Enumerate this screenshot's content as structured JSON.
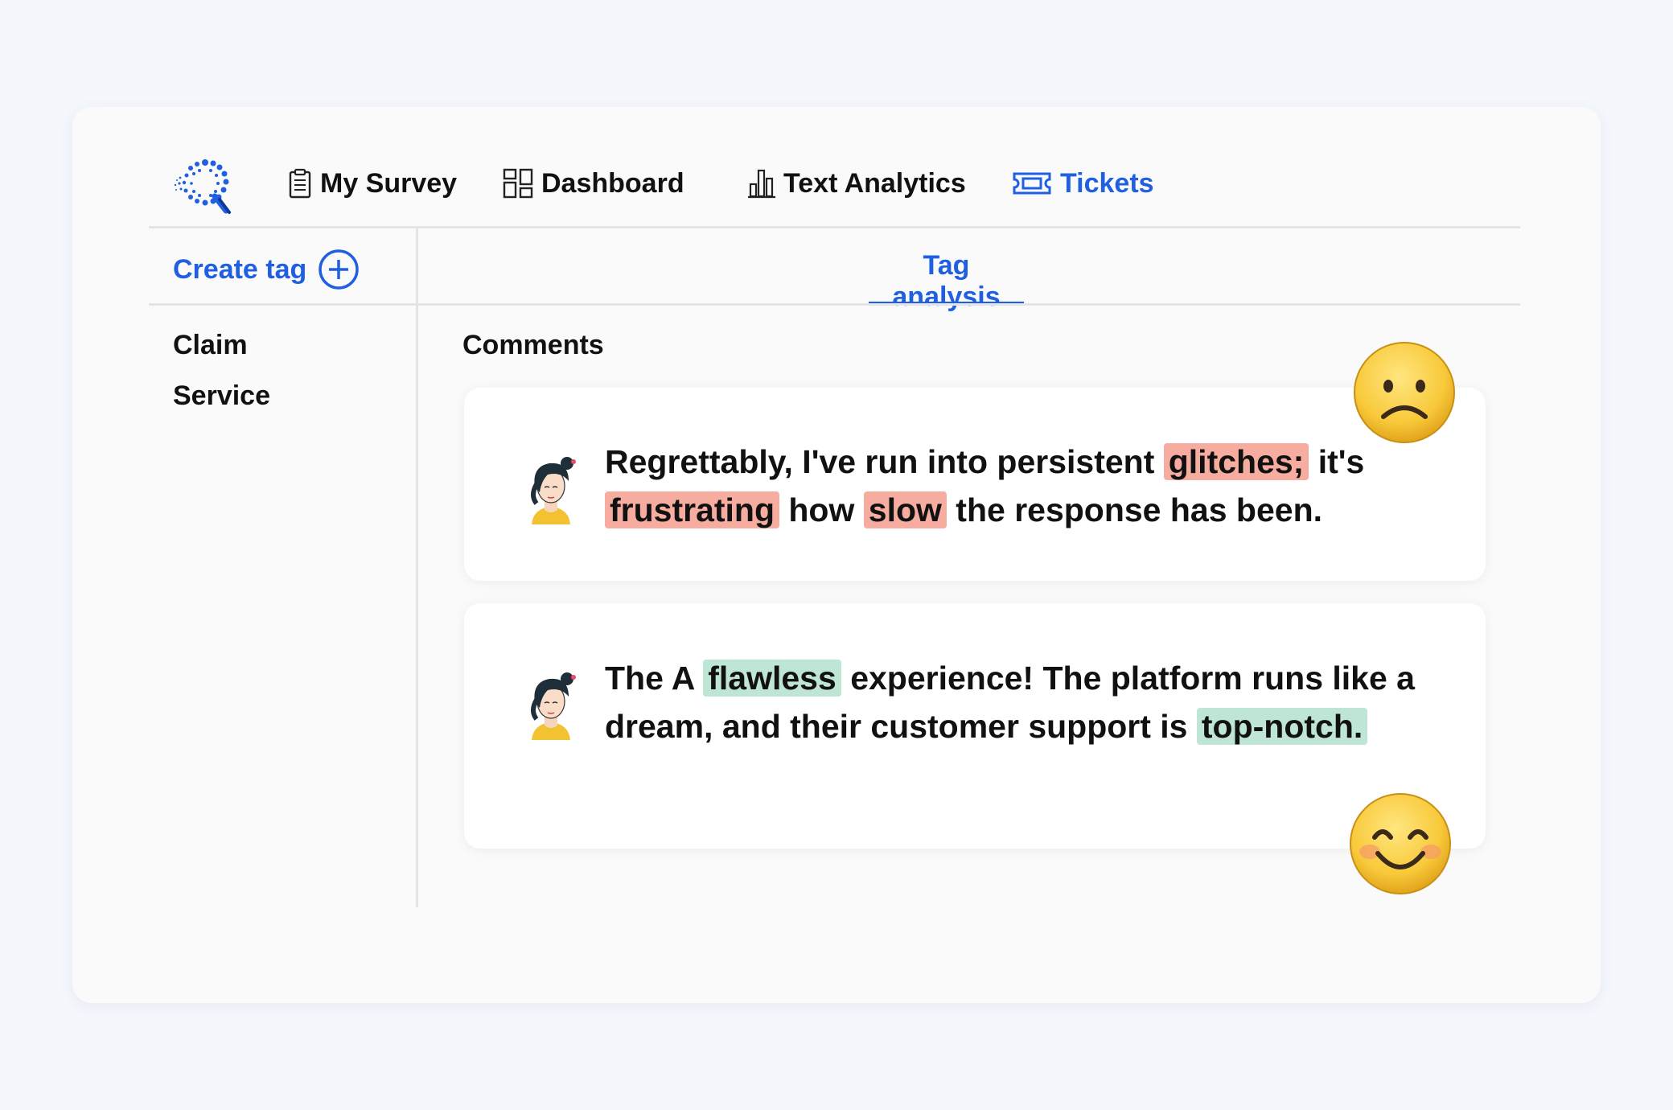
{
  "nav": {
    "items": [
      {
        "label": "My Survey",
        "icon": "clipboard-icon"
      },
      {
        "label": "Dashboard",
        "icon": "dashboard-grid-icon"
      },
      {
        "label": "Text Analytics",
        "icon": "bar-chart-icon"
      },
      {
        "label": "Tickets",
        "icon": "ticket-icon",
        "active": true
      }
    ]
  },
  "sidebar": {
    "create_tag_label": "Create tag",
    "tags": [
      "Claim",
      "Service"
    ]
  },
  "main": {
    "tab_label": "Tag analysis",
    "section_title": "Comments",
    "comments": [
      {
        "sentiment": "negative",
        "emoji": "frowning-face-icon",
        "segments": [
          {
            "text": "Regrettably, I've run into persistent ",
            "highlight": null
          },
          {
            "text": "glitches;",
            "highlight": "negative"
          },
          {
            "text": " it's ",
            "highlight": null
          },
          {
            "text": "frustrating",
            "highlight": "negative"
          },
          {
            "text": " how ",
            "highlight": null
          },
          {
            "text": "slow",
            "highlight": "negative"
          },
          {
            "text": " the response has been.",
            "highlight": null
          }
        ]
      },
      {
        "sentiment": "positive",
        "emoji": "smiling-face-icon",
        "segments": [
          {
            "text": "The A ",
            "highlight": null
          },
          {
            "text": "flawless",
            "highlight": "positive"
          },
          {
            "text": " experience! The platform runs like a dream, and their customer support is ",
            "highlight": null
          },
          {
            "text": "top-notch.",
            "highlight": "positive"
          }
        ]
      }
    ]
  },
  "colors": {
    "accent": "#1f5fe0",
    "negative_highlight": "#f6ada0",
    "positive_highlight": "#bfe6d5",
    "background": "#f4f7fc"
  }
}
